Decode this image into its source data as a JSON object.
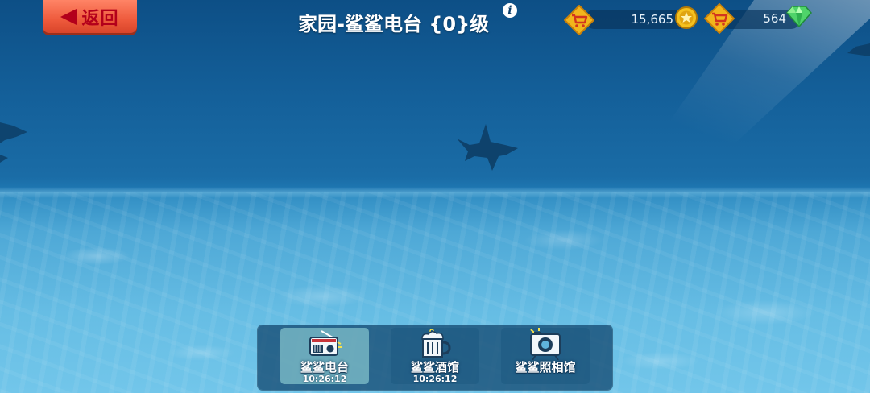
{
  "header": {
    "back_label": "返回",
    "title": "家园-鲨鲨电台 {0}级"
  },
  "resources": {
    "coins": "15,665",
    "gems": "564"
  },
  "dock": {
    "items": [
      {
        "label": "鲨鲨电台",
        "timer": "10:26:12",
        "icon": "radio-icon",
        "active": true
      },
      {
        "label": "鲨鲨酒馆",
        "timer": "10:26:12",
        "icon": "beer-mug-icon",
        "active": false
      },
      {
        "label": "鲨鲨照相馆",
        "timer": "",
        "icon": "camera-icon",
        "active": false
      }
    ]
  },
  "colors": {
    "back_button": "#ee5a3c",
    "cart_button": "#f2b51c",
    "coin": "#f4c21f",
    "gem": "#4fd36a"
  }
}
